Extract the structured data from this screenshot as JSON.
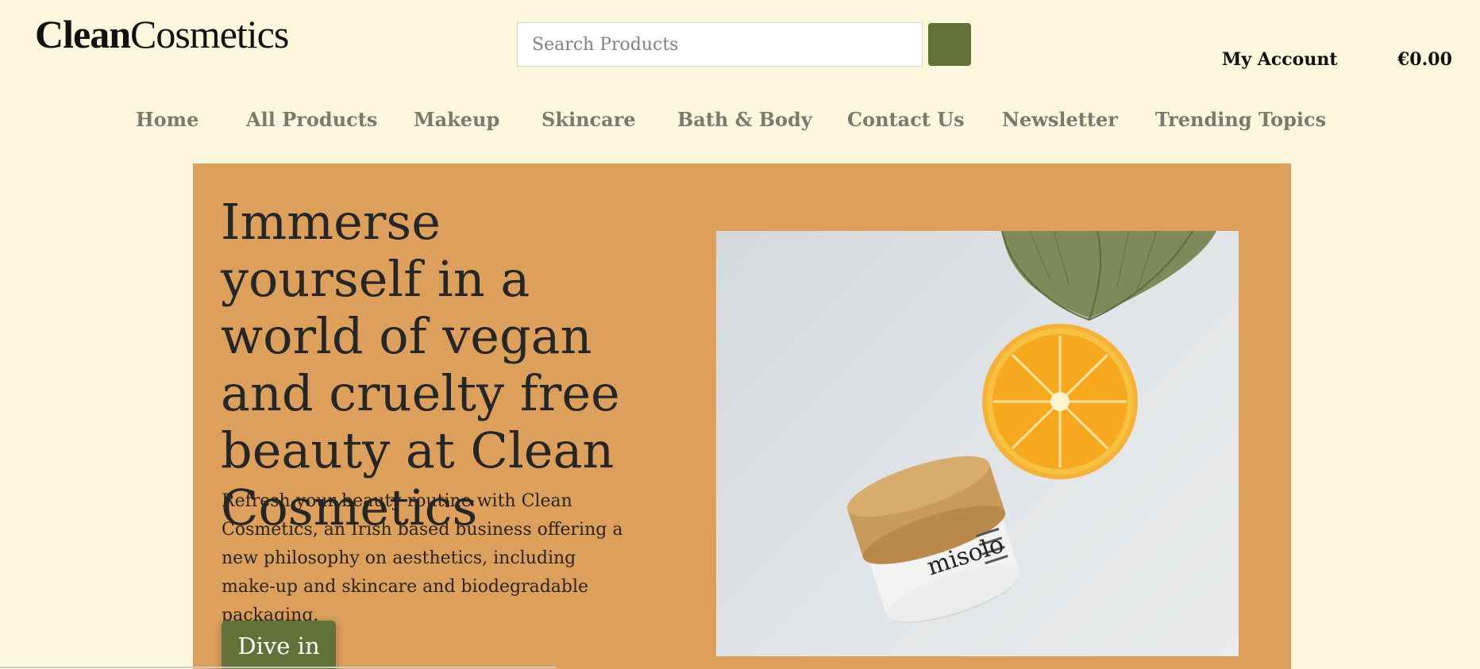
{
  "brand": {
    "part1": "Clean",
    "part2": "Cosmetics"
  },
  "search": {
    "placeholder": "Search Products",
    "value": ""
  },
  "header": {
    "account_label": "My Account",
    "cart_total": "€0.00"
  },
  "nav": {
    "items": [
      {
        "label": "Home"
      },
      {
        "label": "All Products"
      },
      {
        "label": "Makeup"
      },
      {
        "label": "Skincare"
      },
      {
        "label": "Bath & Body"
      },
      {
        "label": "Contact Us"
      },
      {
        "label": "Newsletter"
      },
      {
        "label": "Trending Topics"
      }
    ]
  },
  "hero": {
    "title": "Immerse yourself in a world of vegan and cruelty free beauty at Clean Cosmetics",
    "text": "Refresh your beauty routine with Clean Cosmetics, an Irish based business offering a new philosophy on aesthetics, including make-up and skincare and biodegradable packaging.",
    "cta_label": "Dive in",
    "jar_brand": "misolo"
  },
  "colors": {
    "background": "#fdf8dd",
    "hero_background": "#dca05c",
    "accent_green": "#617137",
    "nav_text": "#7a7a6e"
  },
  "icons": {
    "search_button": "search-icon"
  }
}
